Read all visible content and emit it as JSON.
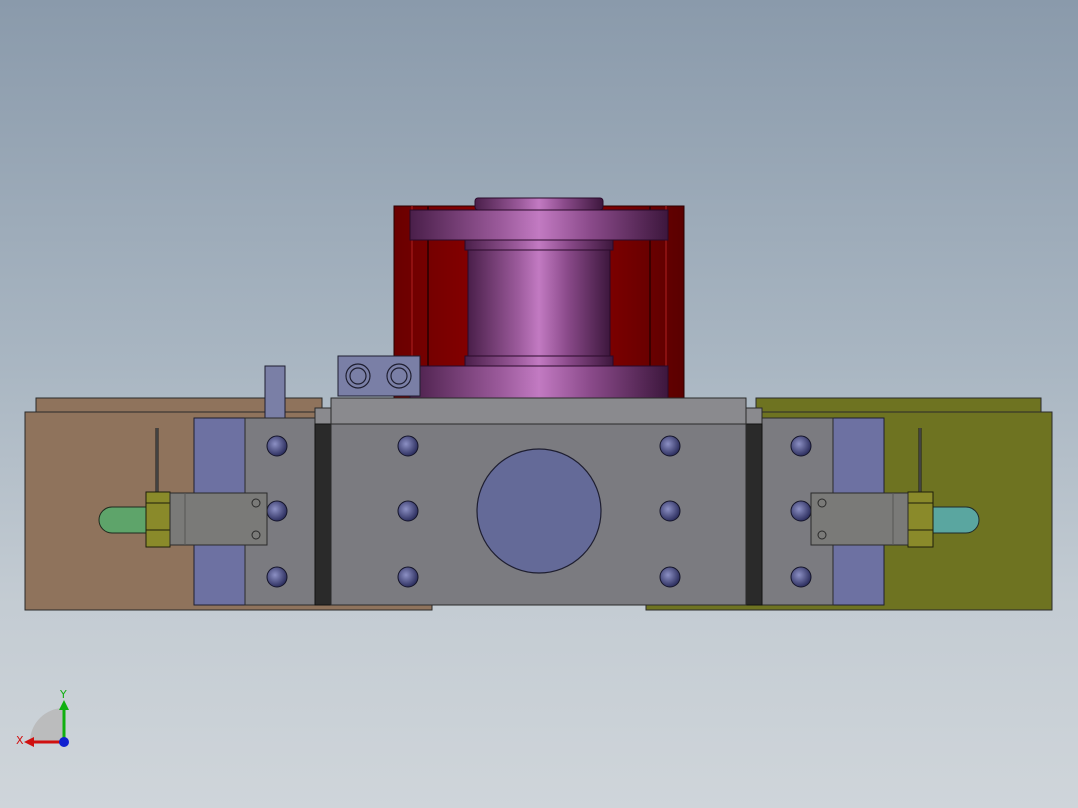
{
  "viewport": {
    "background_top": "#8a9aab",
    "background_bottom": "#cfd5da"
  },
  "model": {
    "colors": {
      "left_plate": "#8f735c",
      "right_plate": "#6e7321",
      "block": "#7b7b80",
      "side_strip": "#6d71a2",
      "cylinder_housing": "#8a0000",
      "spool": "#8a4a8a",
      "hole": "#4b4f8a",
      "center_disk": "#646a98",
      "sensor_body": "#7a7a78",
      "nut": "#8a8a2a",
      "left_tip": "#5ea46a",
      "right_tip": "#5aa6a0"
    }
  },
  "triad": {
    "x_label": "X",
    "y_label": "Y",
    "x_color": "#d01010",
    "y_color": "#10b010",
    "z_color": "#1020d0"
  }
}
